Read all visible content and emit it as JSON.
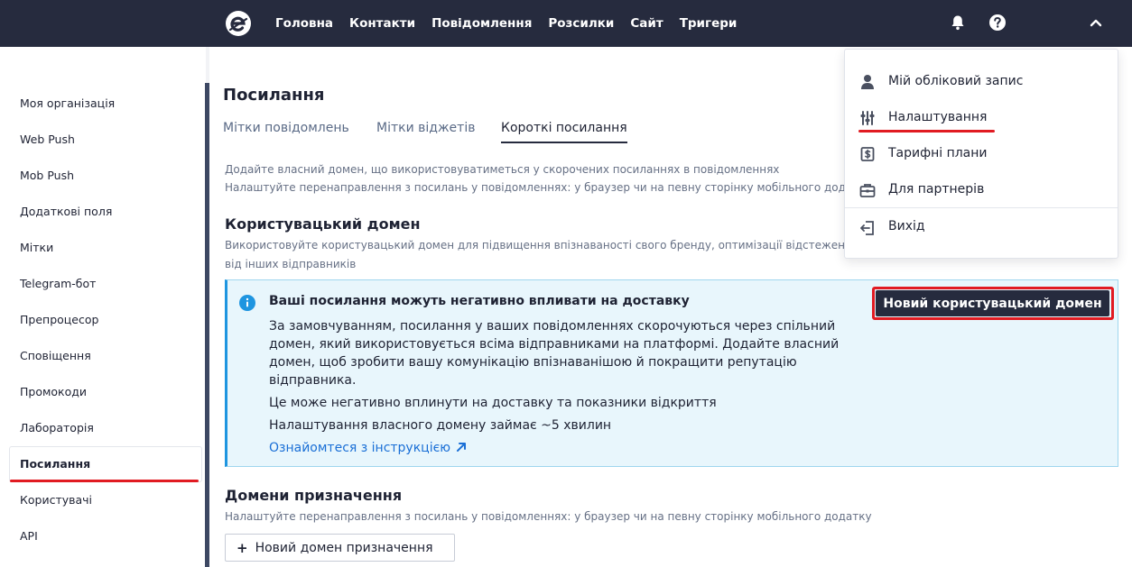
{
  "header": {
    "nav": [
      "Головна",
      "Контакти",
      "Повідомлення",
      "Розсилки",
      "Сайт",
      "Тригери"
    ],
    "icons": [
      "logo-icon",
      "bell-icon",
      "help-icon",
      "chevron-up-icon"
    ]
  },
  "sidebar": {
    "items": [
      "Моя організація",
      "Web Push",
      "Mob Push",
      "Додаткові поля",
      "Мітки",
      "Telegram-бот",
      "Препроцесор",
      "Сповіщення",
      "Промокоди",
      "Лабораторія",
      "Посилання",
      "Користувачі",
      "API"
    ],
    "active": "Посилання"
  },
  "page": {
    "title": "Посилання",
    "tabs": [
      "Мітки повідомлень",
      "Мітки віджетів",
      "Короткі посилання"
    ],
    "active_tab": "Короткі посилання",
    "intro_line1": "Додайте власний домен, що використовуватиметься у скорочених посиланнях в повідомленнях",
    "intro_line2": "Налаштуйте перенаправлення з посилань у повідомленнях: у браузер чи на певну сторінку мобільного додатку",
    "custom_domain": {
      "heading": "Користувацький домен",
      "desc_line1": "Використовуйте користувацький домен для підвищення впізнаваності свого бренду, оптимізації відстеження пе",
      "desc_line2": "від інших відправників",
      "new_button": "Новий користувацький домен"
    },
    "alert": {
      "title": "Ваші посилання можуть негативно впливати на доставку",
      "paragraph": "За замовчуванням, посилання у ваших повідомленнях скорочуються через спільний домен, який використовується всіма відправниками на платформі. Додайте власний домен, щоб зробити вашу комунікацію впізнаванішою й покращити репутацію відправника.",
      "line2": "Це може негативно вплинути на доставку та показники відкриття",
      "line3": "Налаштування власного домену займає ~5 хвилин",
      "link": "Ознайомтеся з інструкцією"
    },
    "destination": {
      "heading": "Домени призначення",
      "desc": "Налаштуйте перенаправлення з посилань у повідомленнях: у браузер чи на певну сторінку мобільного додатку",
      "new_button": "Новий домен призначення",
      "plus": "+"
    }
  },
  "user_menu": {
    "items": [
      "Мій обліковий запис",
      "Налаштування",
      "Тарифні плани",
      "Для партнерів",
      "Вихід"
    ]
  },
  "colors": {
    "topbar": "#262b3e",
    "highlight": "#e11b22",
    "link": "#1a6fd6",
    "alert_bg": "#e8f6fc",
    "alert_border": "#1e95e0"
  }
}
